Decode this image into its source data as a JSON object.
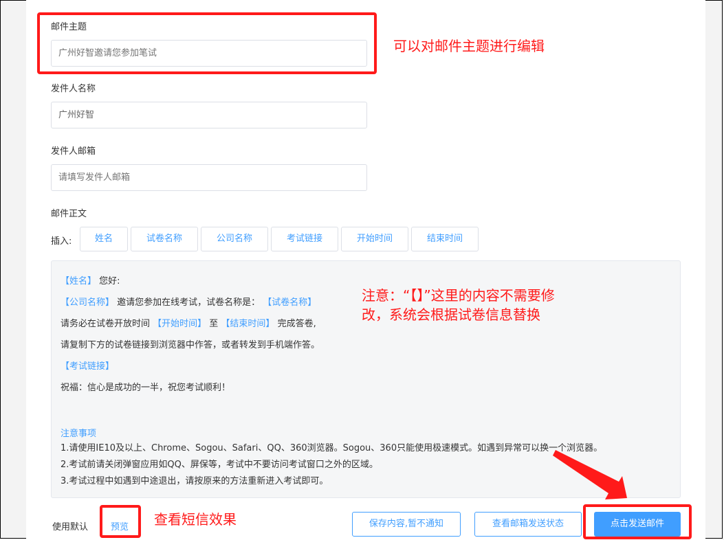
{
  "subject": {
    "label": "邮件主题",
    "placeholder": "广州好智邀请您参加笔试"
  },
  "sender_name": {
    "label": "发件人名称",
    "value": "广州好智"
  },
  "sender_email": {
    "label": "发件人邮箱",
    "placeholder": "请填写发件人邮箱"
  },
  "body_section": {
    "label": "邮件正文",
    "insert_label": "插入:"
  },
  "insert_buttons": [
    "姓名",
    "试卷名称",
    "公司名称",
    "考试链接",
    "开始时间",
    "结束时间"
  ],
  "email_body": {
    "line1_tag": "【姓名】",
    "line1_text": " 您好:",
    "line2_tag": "【公司名称】",
    "line2_text": " 邀请您参加在线考试，试卷名称是：",
    "line2_tag2": " 【试卷名称】",
    "line3_text1": "请务必在试卷开放时间 ",
    "line3_tag1": "【开始时间】",
    "line3_text2": " 至 ",
    "line3_tag2": "【结束时间】",
    "line3_text3": " 完成答卷,",
    "line4_text": "请复制下方的试卷链接到浏览器中作答，或者转发到手机端作答。",
    "line5_tag": "【考试链接】",
    "line6_text": "祝福：信心是成功的一半，祝您考试顺利！",
    "notes_title": "注意事项",
    "notes": [
      "1.请使用IE10及以上、Chrome、Sogou、Safari、QQ、360浏览器。Sogou、360只能使用极速模式。如遇到异常可以换一个浏览器。",
      "2.考试前请关闭弹窗应用如QQ、屏保等，考试中不要访问考试窗口之外的区域。",
      "3.考试过程中如遇到中途退出，请按原来的方法重新进入考试即可。"
    ]
  },
  "footer": {
    "use_default_label": "使用默认",
    "preview_link": "预览",
    "save_button": "保存内容,暂不通知",
    "check_status_button": "查看邮箱发送状态",
    "send_button": "点击发送邮件"
  },
  "annotations": {
    "subject_note": "可以对邮件主题进行编辑",
    "body_note_line1": "注意：“【】”这里的内容不需要修",
    "body_note_line2": "改，系统会根据试卷信息替换",
    "preview_note": "查看短信效果"
  },
  "colors": {
    "accent": "#409eff",
    "annotation": "#ff1a1a"
  }
}
